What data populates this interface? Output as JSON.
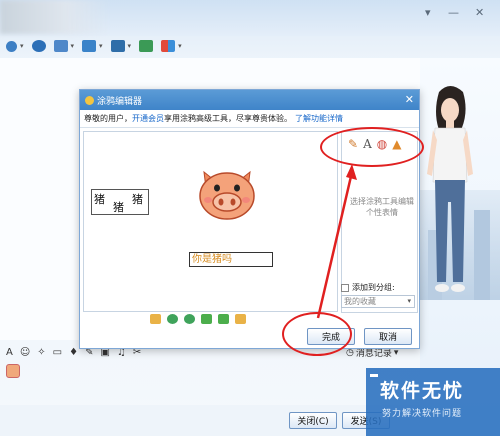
{
  "dialog": {
    "title": "涂鸦编辑器",
    "info_prefix": "尊敬的用户，",
    "info_link_vip": "开通会员",
    "info_middle": "享用涂鸦高级工具，尽享尊贵体验。",
    "info_link_more": "了解功能详情",
    "close_symbol": "✕",
    "canvas": {
      "zhu1": "猪",
      "zhu2": "猪",
      "zhu3": "猪",
      "text_box": "你是猪吗"
    },
    "right_panel": {
      "tool_text": "A",
      "hint": "选择涂鸦工具编辑个性表情",
      "add_group_label": "添加到分组:",
      "group_select": "我的收藏"
    },
    "buttons": {
      "finish": "完成",
      "cancel": "取消"
    }
  },
  "chat": {
    "message_record": "消息记录",
    "close_button": "关闭(C)",
    "send_button": "发送(S)"
  },
  "window_controls": {
    "minimize": "—",
    "close": "✕",
    "more": "▾"
  },
  "watermark": {
    "main": "软件无忧",
    "sub": "努力解决软件问题"
  },
  "colors": {
    "title_bar": "#4a8fd0",
    "link": "#1566c9",
    "annotation": "#e02020",
    "watermark": "#286ebe"
  }
}
